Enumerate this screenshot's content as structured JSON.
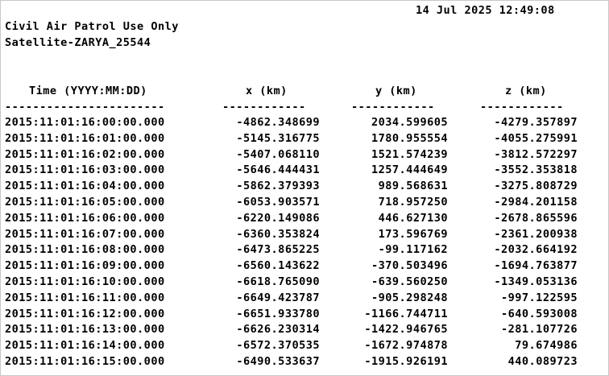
{
  "timestamp": "14 Jul 2025 12:49:08",
  "header": {
    "line1": "Civil Air Patrol Use Only",
    "line2": "Satellite-ZARYA_25544"
  },
  "columns": {
    "time": "Time (YYYY:MM:DD)",
    "x": "x (km)",
    "y": "y (km)",
    "z": "z (km)"
  },
  "dashes": {
    "time": "-----------------------",
    "x": "------------",
    "y": "------------",
    "z": "------------"
  },
  "rows": [
    {
      "time": "2015:11:01:16:00:00.000",
      "x": "-4862.348699",
      "y": "2034.599605",
      "z": "-4279.357897"
    },
    {
      "time": "2015:11:01:16:01:00.000",
      "x": "-5145.316775",
      "y": "1780.955554",
      "z": "-4055.275991"
    },
    {
      "time": "2015:11:01:16:02:00.000",
      "x": "-5407.068110",
      "y": "1521.574239",
      "z": "-3812.572297"
    },
    {
      "time": "2015:11:01:16:03:00.000",
      "x": "-5646.444431",
      "y": "1257.444649",
      "z": "-3552.353818"
    },
    {
      "time": "2015:11:01:16:04:00.000",
      "x": "-5862.379393",
      "y": "989.568631",
      "z": "-3275.808729"
    },
    {
      "time": "2015:11:01:16:05:00.000",
      "x": "-6053.903571",
      "y": "718.957250",
      "z": "-2984.201158"
    },
    {
      "time": "2015:11:01:16:06:00.000",
      "x": "-6220.149086",
      "y": "446.627130",
      "z": "-2678.865596"
    },
    {
      "time": "2015:11:01:16:07:00.000",
      "x": "-6360.353824",
      "y": "173.596769",
      "z": "-2361.200938"
    },
    {
      "time": "2015:11:01:16:08:00.000",
      "x": "-6473.865225",
      "y": "-99.117162",
      "z": "-2032.664192"
    },
    {
      "time": "2015:11:01:16:09:00.000",
      "x": "-6560.143622",
      "y": "-370.503496",
      "z": "-1694.763877"
    },
    {
      "time": "2015:11:01:16:10:00.000",
      "x": "-6618.765090",
      "y": "-639.560250",
      "z": "-1349.053136"
    },
    {
      "time": "2015:11:01:16:11:00.000",
      "x": "-6649.423787",
      "y": "-905.298248",
      "z": "-997.122595"
    },
    {
      "time": "2015:11:01:16:12:00.000",
      "x": "-6651.933780",
      "y": "-1166.744711",
      "z": "-640.593008"
    },
    {
      "time": "2015:11:01:16:13:00.000",
      "x": "-6626.230314",
      "y": "-1422.946765",
      "z": "-281.107726"
    },
    {
      "time": "2015:11:01:16:14:00.000",
      "x": "-6572.370535",
      "y": "-1672.974878",
      "z": "79.674986"
    },
    {
      "time": "2015:11:01:16:15:00.000",
      "x": "-6490.533637",
      "y": "-1915.926191",
      "z": "440.089723"
    }
  ]
}
